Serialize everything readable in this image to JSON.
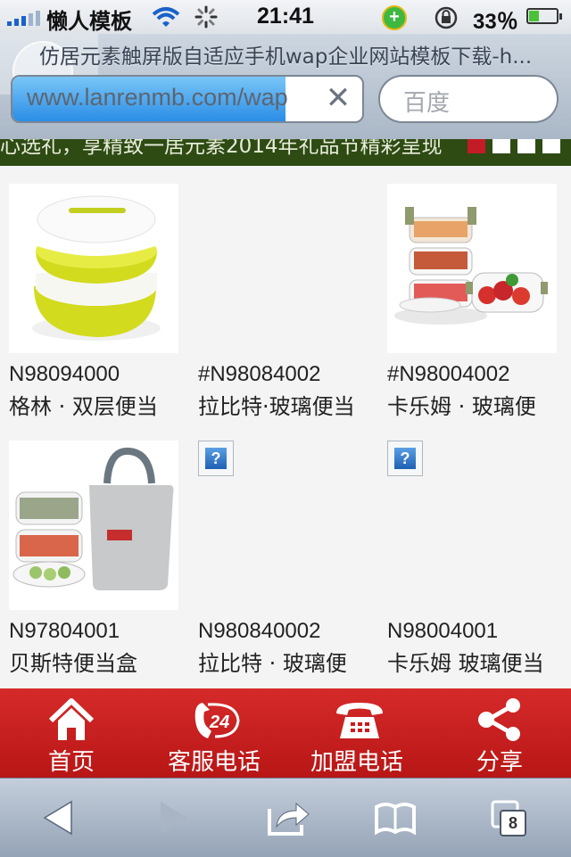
{
  "status_bar": {
    "carrier": "懒人模板",
    "time": "21:41",
    "battery_percent": "33％",
    "battery_level": 0.33,
    "icons": [
      "signal-icon",
      "wifi-icon",
      "activity-spinner-icon",
      "plus-badge-icon",
      "rotation-lock-icon",
      "battery-icon"
    ]
  },
  "browser": {
    "page_title": "仿居元素触屏版自适应手机wap企业网站模板下载-h...",
    "url": "www.lanrenmb.com/wap",
    "load_progress": 0.78,
    "search_placeholder": "百度"
  },
  "marquee": {
    "text": "心选礼，享精致一居元素2014年礼品节精彩呈现"
  },
  "products": [
    {
      "code": "N98094000",
      "name": "格林 · 双层便当",
      "image": "yellow-lunchbox"
    },
    {
      "code": "#N98084002",
      "name": "拉比特·玻璃便当",
      "image": "missing"
    },
    {
      "code": "#N98004002",
      "name": "卡乐姆 · 玻璃便",
      "image": "glass-stack-lunchbox"
    },
    {
      "code": "N97804001",
      "name": "贝斯特便当盒",
      "image": "lunchbox-with-bag"
    },
    {
      "code": "N980840002",
      "name": "拉比特 · 玻璃便",
      "image": "missing"
    },
    {
      "code": "N98004001",
      "name": "卡乐姆 玻璃便当",
      "image": "missing"
    }
  ],
  "bottom_nav": [
    {
      "label": "首页",
      "icon": "home-icon"
    },
    {
      "label": "客服电话",
      "icon": "phone-24h-icon"
    },
    {
      "label": "加盟电话",
      "icon": "telephone-icon"
    },
    {
      "label": "分享",
      "icon": "share-icon"
    }
  ],
  "toolbar": {
    "tabs_count": "8",
    "icons": [
      "back-icon",
      "forward-icon",
      "share-action-icon",
      "bookmarks-icon",
      "tabs-icon"
    ]
  },
  "colors": {
    "nav_red": "#c81e1e",
    "marquee_green": "#2e4b14",
    "progress_blue": "#2b8de6"
  }
}
